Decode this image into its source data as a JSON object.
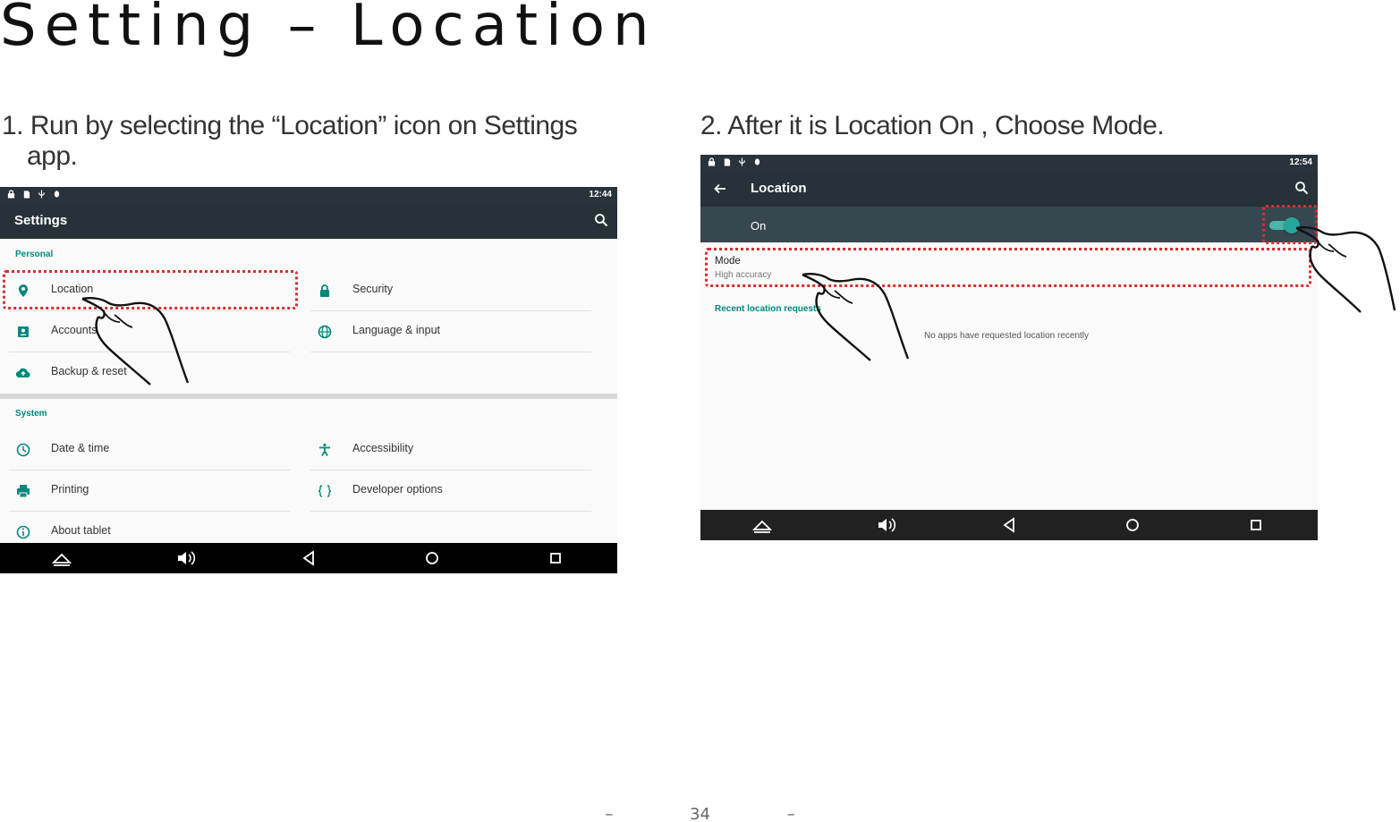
{
  "page": {
    "title": "Setting – Location",
    "step1": "1. Run by selecting the “Location” icon on Settings app.",
    "step2": "2. After it is Location On , Choose Mode.",
    "footer_left": "–",
    "page_number": "34",
    "footer_right": "–"
  },
  "shot1": {
    "time": "12:44",
    "app_title": "Settings",
    "personal_header": "Personal",
    "personal_left": [
      {
        "label": "Location",
        "icon": "location-pin-icon"
      },
      {
        "label": "Accounts",
        "icon": "account-icon"
      },
      {
        "label": "Backup & reset",
        "icon": "cloud-upload-icon"
      }
    ],
    "personal_right": [
      {
        "label": "Security",
        "icon": "lock-icon"
      },
      {
        "label": "Language & input",
        "icon": "globe-icon"
      }
    ],
    "system_header": "System",
    "system_left": [
      {
        "label": "Date & time",
        "icon": "clock-icon"
      },
      {
        "label": "Printing",
        "icon": "printer-icon"
      },
      {
        "label": "About tablet",
        "icon": "info-icon"
      }
    ],
    "system_right": [
      {
        "label": "Accessibility",
        "icon": "accessibility-icon"
      },
      {
        "label": "Developer options",
        "icon": "code-braces-icon"
      }
    ]
  },
  "shot2": {
    "time": "12:54",
    "app_title": "Location",
    "on_label": "On",
    "toggle_on": true,
    "mode_title": "Mode",
    "mode_value": "High accuracy",
    "recent_header": "Recent location requests",
    "empty_message": "No apps have requested location recently"
  },
  "colors": {
    "accent": "#00897b",
    "appbar": "#263238",
    "highlight": "#d32f2f"
  }
}
